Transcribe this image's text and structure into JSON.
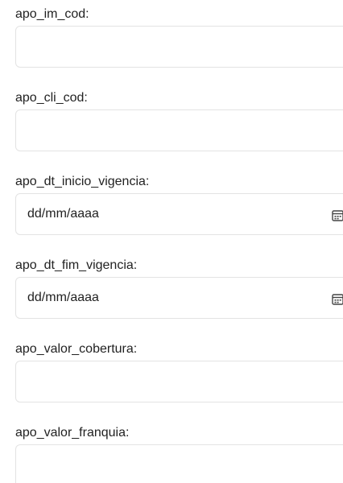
{
  "form": {
    "fields": [
      {
        "label": "apo_im_cod:",
        "value": ""
      },
      {
        "label": "apo_cli_cod:",
        "value": ""
      },
      {
        "label": "apo_dt_inicio_vigencia:",
        "placeholder": "dd/mm/aaaa",
        "icon": "calendar-icon"
      },
      {
        "label": "apo_dt_fim_vigencia:",
        "placeholder": "dd/mm/aaaa",
        "icon": "calendar-icon"
      },
      {
        "label": "apo_valor_cobertura:",
        "value": ""
      },
      {
        "label": "apo_valor_franquia:",
        "value": ""
      }
    ]
  }
}
